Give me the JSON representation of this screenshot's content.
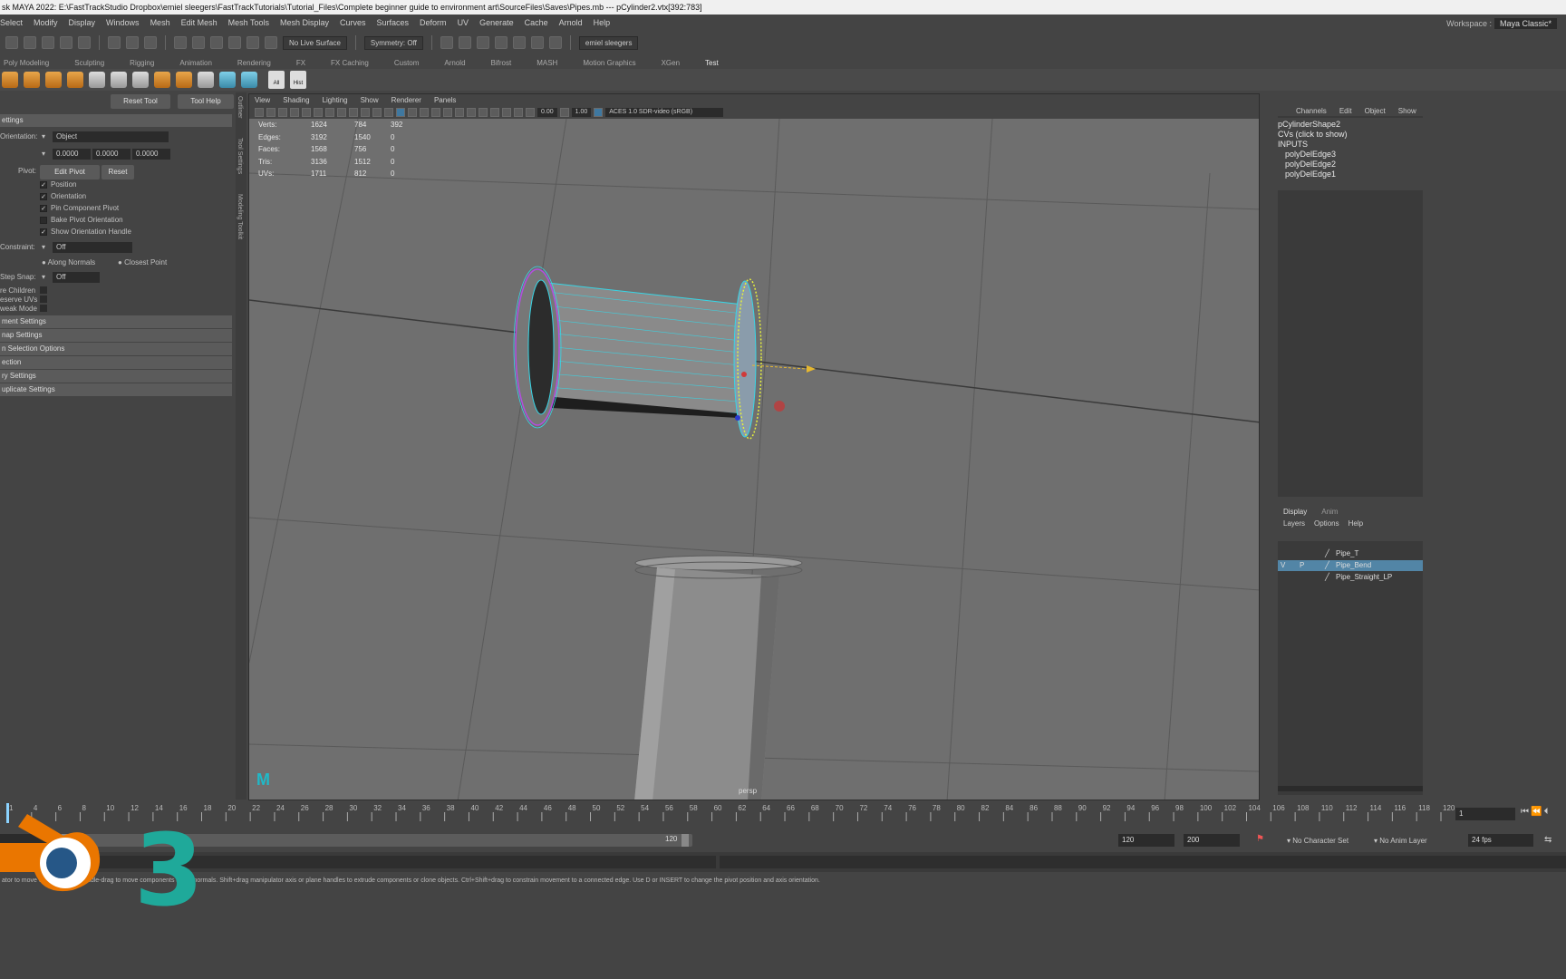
{
  "title_bar": "sk MAYA 2022: E:\\FastTrackStudio Dropbox\\emiel sleegers\\FastTrackTutorials\\Tutorial_Files\\Complete beginner guide to environment art\\SourceFiles\\Saves\\Pipes.mb  ---  pCylinder2.vtx[392:783]",
  "menu": [
    "Select",
    "Modify",
    "Display",
    "Windows",
    "Mesh",
    "Edit Mesh",
    "Mesh Tools",
    "Mesh Display",
    "Curves",
    "Surfaces",
    "Deform",
    "UV",
    "Generate",
    "Cache",
    "Arnold",
    "Help"
  ],
  "workspace": {
    "label": "Workspace :",
    "value": "Maya Classic*"
  },
  "status_line": {
    "live_surface": "No Live Surface",
    "symmetry": "Symmetry: Off",
    "user": "emiel sleegers"
  },
  "shelf_tabs": [
    "Poly Modeling",
    "Sculpting",
    "Rigging",
    "Animation",
    "Rendering",
    "FX",
    "FX Caching",
    "Custom",
    "Arnold",
    "Bifrost",
    "MASH",
    "Motion Graphics",
    "XGen",
    "Test"
  ],
  "shelf_labels": {
    "all": "All",
    "hist": "Hist"
  },
  "tool_settings": {
    "reset_tool": "Reset Tool",
    "tool_help": "Tool Help",
    "section_title": "ettings",
    "orientation_label": "Orientation:",
    "orientation_value": "Object",
    "xyz": [
      "0.0000",
      "0.0000",
      "0.0000"
    ],
    "pivot_label": "Pivot:",
    "edit_pivot": "Edit Pivot",
    "reset": "Reset",
    "checks": [
      "Position",
      "Orientation",
      "Pin Component Pivot",
      "Bake Pivot Orientation",
      "Show Orientation Handle"
    ],
    "constraint_label": "Constraint:",
    "constraint_value": "Off",
    "along_normals": "Along Normals",
    "closest_point": "Closest Point",
    "step_snap_label": "Step Snap:",
    "step_snap_value": "Off",
    "misc": [
      "re Children",
      "eserve UVs",
      "weak Mode"
    ],
    "sections": [
      "ment Settings",
      "nap Settings",
      "n Selection Options",
      "ection",
      "ry Settings",
      "uplicate Settings"
    ]
  },
  "side_tabs": [
    "Outliner",
    "Tool Settings",
    "Modeling Toolkit"
  ],
  "viewport": {
    "menu": [
      "View",
      "Shading",
      "Lighting",
      "Show",
      "Renderer",
      "Panels"
    ],
    "field1": "0.00",
    "field2": "1.00",
    "color_space": "ACES 1.0 SDR-video (sRGB)",
    "camera": "persp",
    "hud": [
      {
        "label": "Verts:",
        "a": "1624",
        "b": "784",
        "c": "392"
      },
      {
        "label": "Edges:",
        "a": "3192",
        "b": "1540",
        "c": "0"
      },
      {
        "label": "Faces:",
        "a": "1568",
        "b": "756",
        "c": "0"
      },
      {
        "label": "Tris:",
        "a": "3136",
        "b": "1512",
        "c": "0"
      },
      {
        "label": "UVs:",
        "a": "1711",
        "b": "812",
        "c": "0"
      }
    ]
  },
  "channel_box": {
    "tabs": [
      "Channels",
      "Edit",
      "Object",
      "Show"
    ],
    "shape": "pCylinderShape2",
    "cvs": "CVs (click to show)",
    "inputs_label": "INPUTS",
    "inputs": [
      "polyDelEdge3",
      "polyDelEdge2",
      "polyDelEdge1"
    ]
  },
  "layer_editor": {
    "tabs": [
      "Display",
      "Anim"
    ],
    "menu": [
      "Layers",
      "Options",
      "Help"
    ],
    "layers": [
      "Pipe_T",
      "Pipe_Bend",
      "Pipe_Straight_LP"
    ],
    "flags": [
      "V",
      "P"
    ]
  },
  "time_slider": {
    "ticks": [
      "1",
      "4",
      "6",
      "8",
      "10",
      "12",
      "14",
      "16",
      "18",
      "20",
      "22",
      "24",
      "26",
      "28",
      "30",
      "32",
      "34",
      "36",
      "38",
      "40",
      "42",
      "44",
      "46",
      "48",
      "50",
      "52",
      "54",
      "56",
      "58",
      "60",
      "62",
      "64",
      "66",
      "68",
      "70",
      "72",
      "74",
      "76",
      "78",
      "80",
      "82",
      "84",
      "86",
      "88",
      "90",
      "92",
      "94",
      "96",
      "98",
      "100",
      "102",
      "104",
      "106",
      "108",
      "110",
      "112",
      "114",
      "116",
      "118",
      "120"
    ],
    "current_frame": "1"
  },
  "range_slider": {
    "start": "1",
    "range_start": "1",
    "range_end": "120",
    "end": "120",
    "max": "200",
    "character_set": "No Character Set",
    "anim_layer": "No Anim Layer",
    "fps": "24 fps"
  },
  "help_line": "ator to move object(s). Ctrl+middle-drag to move components along normals. Shift+drag manipulator axis or plane handles to extrude components or clone objects. Ctrl+Shift+drag to constrain movement to a connected edge. Use D or INSERT to change the pivot position and axis orientation.",
  "colors": {
    "selection_blue": "#5285a6",
    "wire_cyan": "#37d6e6",
    "vertex_yellow": "#e6f03c",
    "wire_purple": "#b34ee0",
    "grid_dark": "#505050"
  },
  "watermark": {
    "blender_logo": "blender-logo",
    "number": "3"
  }
}
